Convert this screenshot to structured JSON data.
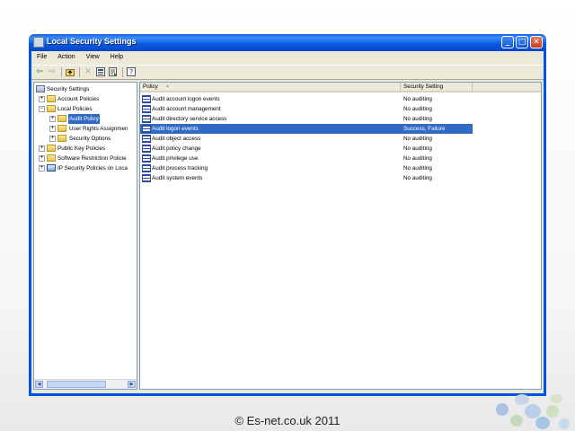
{
  "window": {
    "title": "Local Security Settings",
    "buttons": {
      "minimize": "_",
      "maximize": "□",
      "close": "✕"
    }
  },
  "menu": [
    "File",
    "Action",
    "View",
    "Help"
  ],
  "toolbar": {
    "icons": [
      "back-icon",
      "forward-icon",
      "up-folder-icon",
      "delete-icon",
      "properties-icon",
      "export-icon",
      "help-icon"
    ]
  },
  "tree": {
    "root": "Security Settings",
    "account_policies": "Account Policies",
    "local_policies": "Local Policies",
    "audit_policy": "Audit Policy",
    "user_rights": "User Rights Assignmen",
    "security_options": "Security Options",
    "public_key": "Public Key Policies",
    "software_restriction": "Software Restriction Policie",
    "ip_security": "IP Security Policies on Loca"
  },
  "list": {
    "columns": [
      "Policy",
      "Security Setting"
    ],
    "rows": [
      {
        "policy": "Audit account logon events",
        "setting": "No auditing"
      },
      {
        "policy": "Audit account management",
        "setting": "No auditing"
      },
      {
        "policy": "Audit directory service access",
        "setting": "No auditing"
      },
      {
        "policy": "Audit logon events",
        "setting": "Success, Failure"
      },
      {
        "policy": "Audit object access",
        "setting": "No auditing"
      },
      {
        "policy": "Audit policy change",
        "setting": "No auditing"
      },
      {
        "policy": "Audit privilege use",
        "setting": "No auditing"
      },
      {
        "policy": "Audit process tracking",
        "setting": "No auditing"
      },
      {
        "policy": "Audit system events",
        "setting": "No auditing"
      }
    ],
    "selected_index": 3
  },
  "footer": "© Es-net.co.uk 2011",
  "colors": {
    "titlebar": "#0a58dc",
    "selection": "#316ac5",
    "window_bg": "#ece9d8"
  }
}
